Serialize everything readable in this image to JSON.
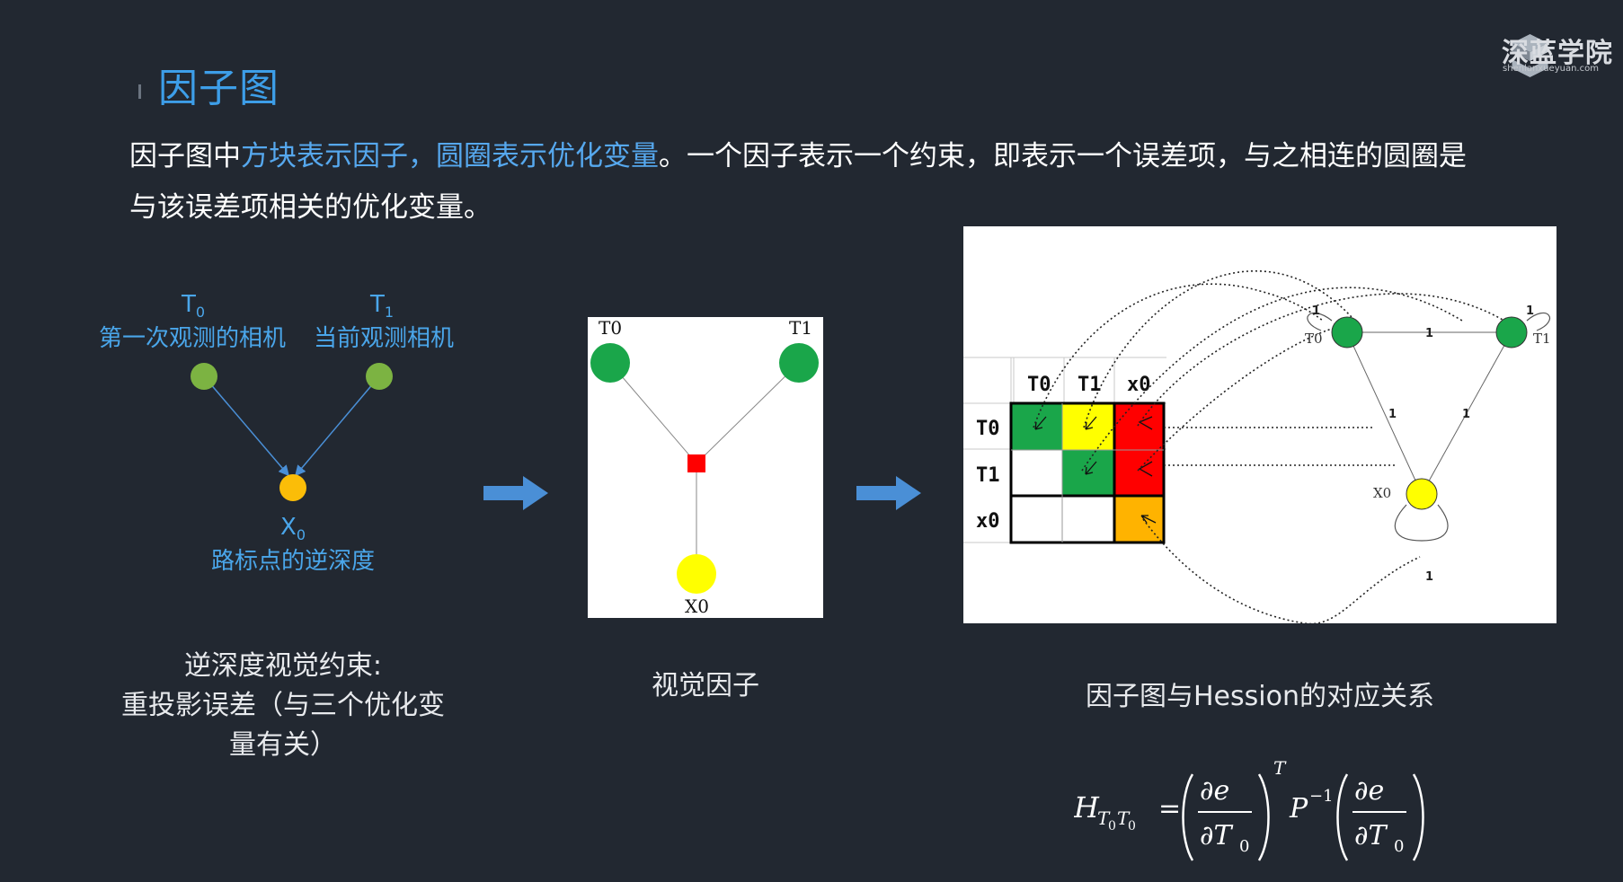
{
  "slide": {
    "title": "因子图",
    "logo_text": "深蓝学院",
    "logo_url": "shenlanxueyuan.com",
    "para_line1_a": "因子图中",
    "para_line1_b": "方块表示因子，圆圈表示优化变量",
    "para_line1_c": "。一个因子表示一个约束，即表示一个误差项，与之相连的圆圈是",
    "para_line2": "与该误差项相关的优化变量。"
  },
  "left_diagram": {
    "t0_symbol": "T",
    "t0_sub": "0",
    "t0_desc": "第一次观测的相机",
    "t1_symbol": "T",
    "t1_sub": "1",
    "t1_desc": "当前观测相机",
    "x0_symbol": "X",
    "x0_sub": "0",
    "x0_desc": "路标点的逆深度",
    "caption_line1": "逆深度视觉约束:",
    "caption_line2": "重投影误差（与三个优化变",
    "caption_line3": "量有关）"
  },
  "mid_diagram": {
    "t0": "T0",
    "t1": "T1",
    "x0": "X0",
    "caption": "视觉因子"
  },
  "right_diagram": {
    "col_headers": [
      "T0",
      "T1",
      "x0"
    ],
    "row_headers": [
      "T0",
      "T1",
      "x0"
    ],
    "cell_colors": [
      [
        "#1aa64a",
        "#ffff00",
        "#ff0000"
      ],
      [
        "#ffffff",
        "#1aa64a",
        "#ff0000"
      ],
      [
        "#ffffff",
        "#ffffff",
        "#ffb300"
      ]
    ],
    "graph_t0": "T0",
    "graph_t1": "T1",
    "graph_x0": "X0",
    "edge_weight": "1",
    "caption": "因子图与Hession的对应关系"
  },
  "formula": {
    "lhs": "H",
    "lhs_sub1": "T",
    "lhs_sub1_idx": "0",
    "lhs_sub2": "T",
    "lhs_sub2_idx": "0",
    "eq": "=",
    "numer": "∂e",
    "denom": "∂T",
    "denom_idx": "0",
    "transpose": "T",
    "p": "P",
    "p_exp": "−1"
  },
  "colors": {
    "background": "#222831",
    "accent_blue": "#3d9ee8",
    "node_green": "#1aa64a",
    "node_yellow": "#ffff00",
    "factor_red": "#ff0000",
    "arrow_blue": "#4a8fd6"
  }
}
